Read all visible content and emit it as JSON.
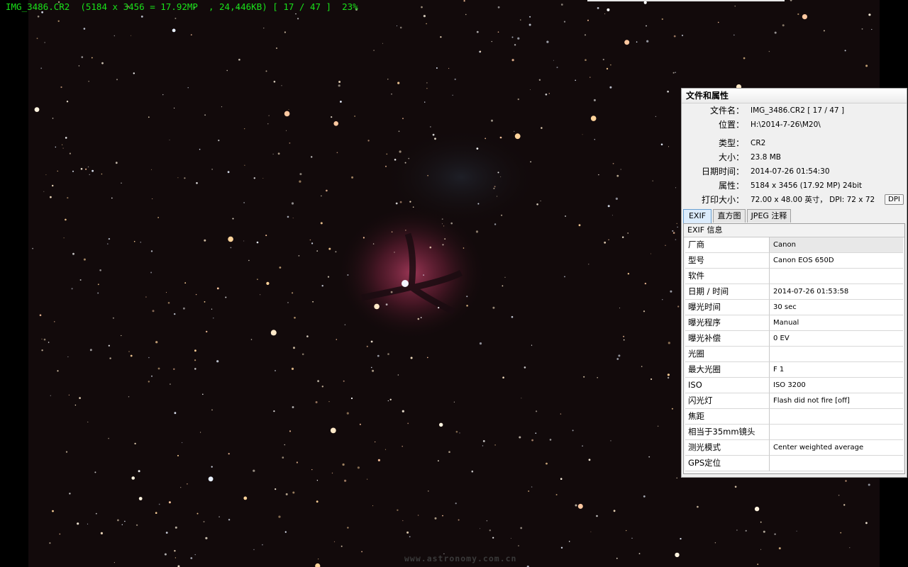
{
  "viewer": {
    "info_bar": "IMG_3486.CR2  (5184 x 3456 = 17.92MP  , 24,446KB) [ 17 / 47 ]  23%",
    "watermark": "www.astronomy.com.cn",
    "colors": {
      "info_text": "#19e019",
      "sky": "#120a0b",
      "nebula": "#8a2a44"
    }
  },
  "panel": {
    "title": "文件和属性",
    "properties": [
      {
        "label": "文件名",
        "value": "IMG_3486.CR2  [ 17 / 47 ]"
      },
      {
        "label": "位置",
        "value": "H:\\2014-7-26\\M20\\"
      },
      {
        "label": "类型",
        "value": "CR2"
      },
      {
        "label": "大小",
        "value": "23.8 MB"
      },
      {
        "label": "日期时间",
        "value": "2014-07-26 01:54:30"
      },
      {
        "label": "属性",
        "value": "5184 x 3456 (17.92 MP)  24bit"
      },
      {
        "label": "打印大小",
        "value": "72.00 x 48.00 英寸，  DPI: 72 x 72"
      }
    ],
    "dpi_button": "DPI",
    "tabs": [
      {
        "label": "EXIF",
        "active": true
      },
      {
        "label": "直方图",
        "active": false
      },
      {
        "label": "JPEG 注释",
        "active": false
      }
    ],
    "exif_header": "EXIF 信息",
    "exif_rows": [
      {
        "key": "厂商",
        "value": "Canon"
      },
      {
        "key": "型号",
        "value": "Canon EOS 650D"
      },
      {
        "key": "软件",
        "value": ""
      },
      {
        "key": "日期 / 时间",
        "value": "2014-07-26 01:53:58"
      },
      {
        "key": "曝光时间",
        "value": "30 sec"
      },
      {
        "key": "曝光程序",
        "value": "Manual"
      },
      {
        "key": "曝光补偿",
        "value": "0 EV"
      },
      {
        "key": "光圈",
        "value": ""
      },
      {
        "key": "最大光圈",
        "value": "F 1"
      },
      {
        "key": "ISO",
        "value": "ISO 3200"
      },
      {
        "key": "闪光灯",
        "value": "Flash did not fire [off]"
      },
      {
        "key": "焦距",
        "value": ""
      },
      {
        "key": "相当于35mm镜头",
        "value": ""
      },
      {
        "key": "测光模式",
        "value": "Center weighted average"
      },
      {
        "key": "GPS定位",
        "value": ""
      }
    ]
  }
}
